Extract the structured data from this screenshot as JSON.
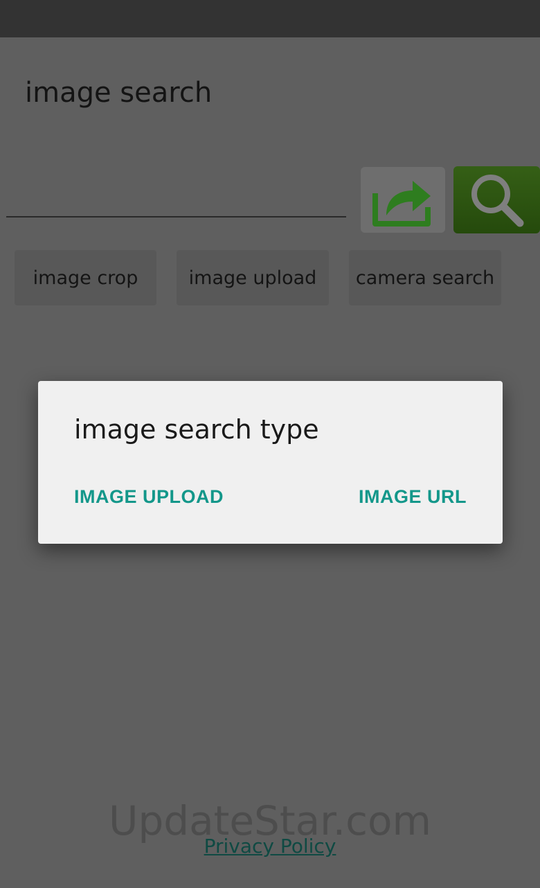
{
  "app": {
    "title": "image search"
  },
  "search": {
    "value": "",
    "placeholder": ""
  },
  "buttons": {
    "share_icon": "share-icon",
    "search_icon": "search-icon",
    "share_color": "#2e7d1f",
    "search_color": "#2f5a12"
  },
  "chips": [
    {
      "label": "image crop"
    },
    {
      "label": "image upload"
    },
    {
      "label": "camera search"
    }
  ],
  "dialog": {
    "title": "image search type",
    "actions": [
      {
        "label": "IMAGE UPLOAD"
      },
      {
        "label": "IMAGE URL"
      }
    ],
    "accent_color": "#13978a"
  },
  "footer": {
    "privacy_link": "Privacy Policy"
  },
  "watermark": "UpdateStar.com"
}
